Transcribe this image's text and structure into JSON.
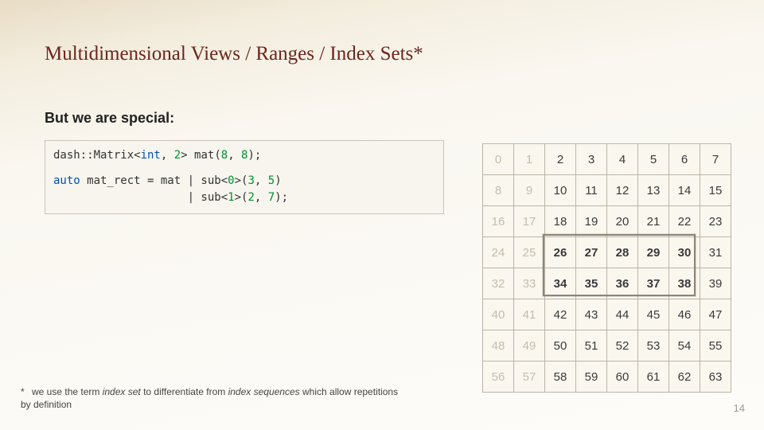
{
  "title": "Multidimensional Views / Ranges / Index Sets*",
  "subtitle": "But we are special:",
  "code": {
    "line1_a": "dash::Matrix<",
    "line1_b": "int",
    "line1_c": ", ",
    "line1_d": "2",
    "line1_e": "> mat(",
    "line1_f": "8",
    "line1_g": ", ",
    "line1_h": "8",
    "line1_i": ");",
    "line2_a": "auto",
    "line2_b": " mat_rect = mat | sub<",
    "line2_c": "0",
    "line2_d": ">(",
    "line2_e": "3",
    "line2_f": ", ",
    "line2_g": "5",
    "line2_h": ")",
    "line3_a": "                    | sub<",
    "line3_b": "1",
    "line3_c": ">(",
    "line3_d": "2",
    "line3_e": ", ",
    "line3_f": "7",
    "line3_g": ");"
  },
  "grid": {
    "rows": 8,
    "cols": 8,
    "dim_cols": [
      0,
      1
    ],
    "highlight": {
      "row_start": 3,
      "row_end": 4,
      "col_start": 2,
      "col_end": 6
    }
  },
  "footnote_star": "*",
  "footnote_a": "we use the term ",
  "footnote_b": "index set",
  "footnote_c": " to differentiate from ",
  "footnote_d": "index sequences",
  "footnote_e": " which allow repetitions by definition",
  "pagenum": "14"
}
